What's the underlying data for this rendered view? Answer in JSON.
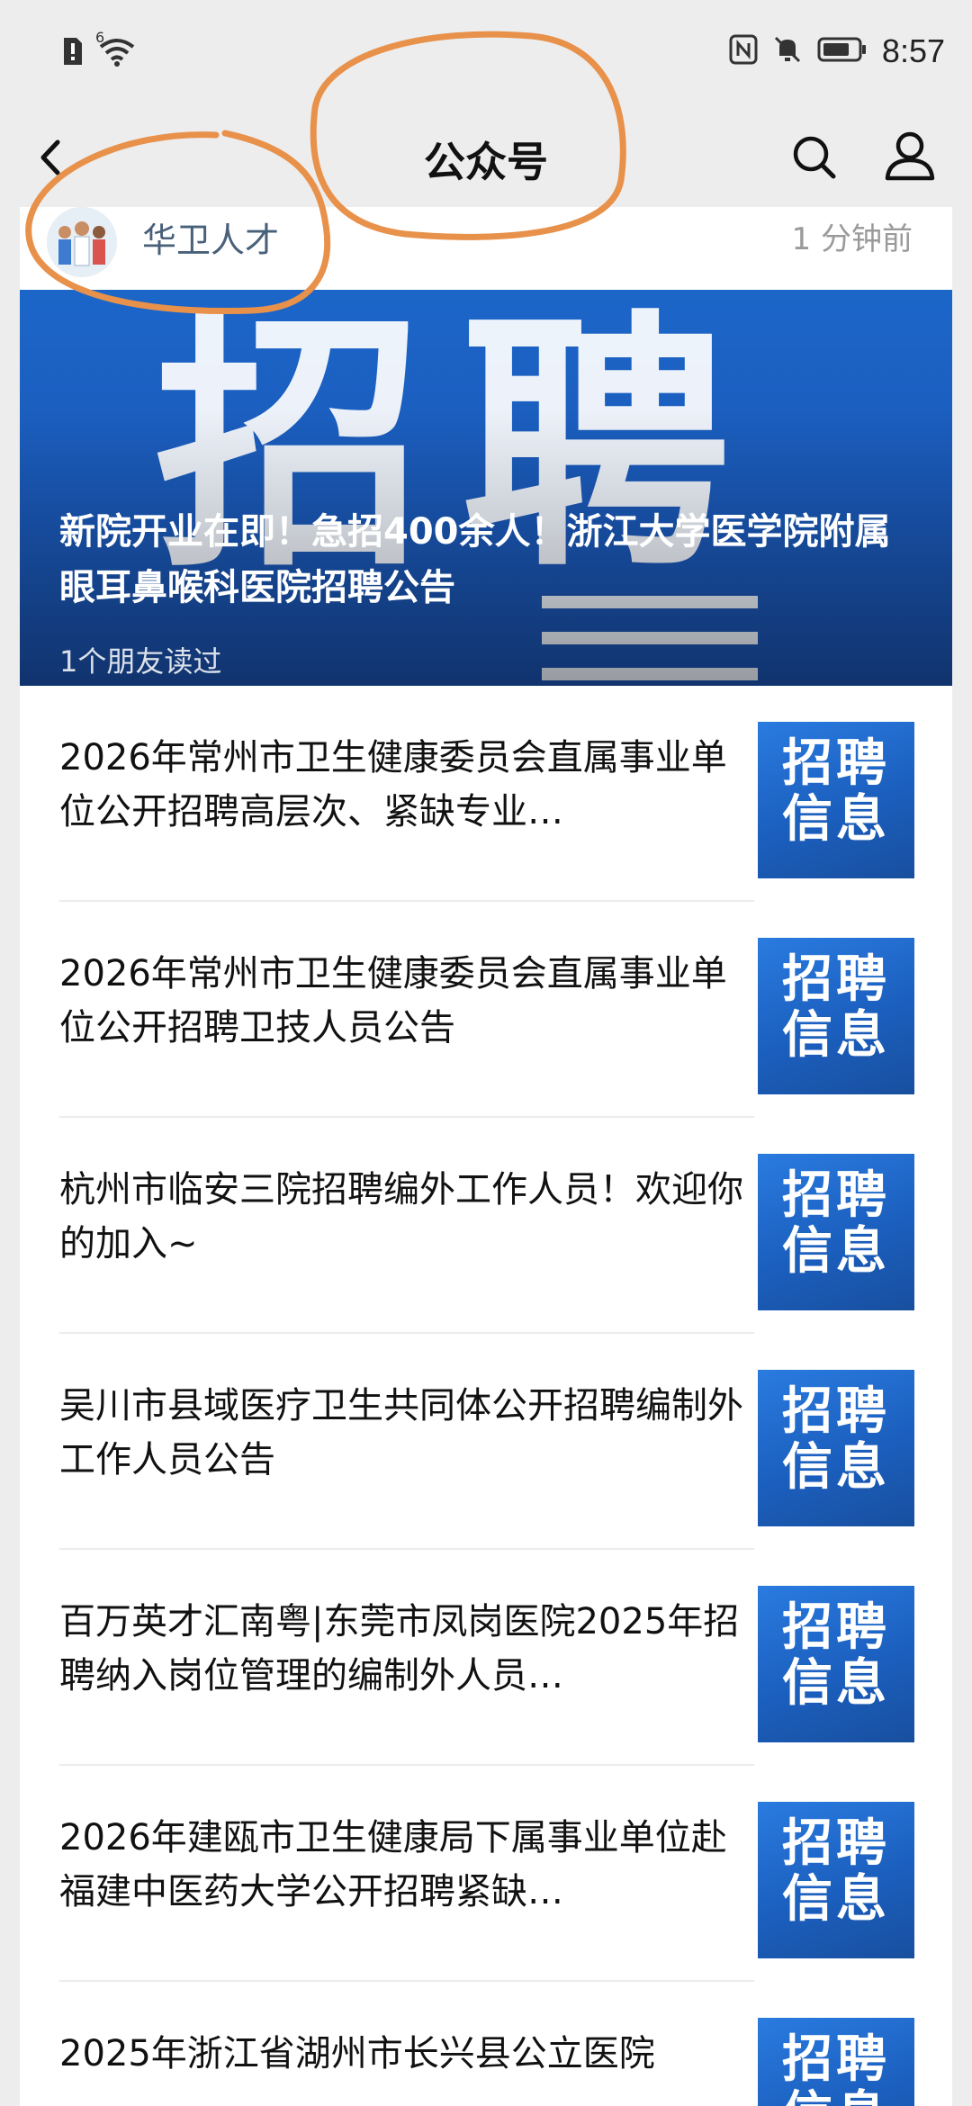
{
  "status_bar": {
    "time": "8:57",
    "network_badge": "6",
    "icons": [
      "sim-alert-icon",
      "wifi-icon",
      "nfc-icon",
      "mute-icon",
      "battery-icon"
    ]
  },
  "nav": {
    "title": "公众号",
    "icons": [
      "back-icon",
      "search-icon",
      "profile-icon"
    ]
  },
  "account": {
    "name": "华卫人才",
    "time": "1 分钟前"
  },
  "hero": {
    "banner_text": "招聘",
    "title": "新院开业在即！急招400余人！浙江大学医学院附属眼耳鼻喉科医院招聘公告",
    "meta": "1个朋友读过"
  },
  "articles": [
    {
      "title": "2026年常州市卫生健康委员会直属事业单位公开招聘高层次、紧缺专业…",
      "thumb_line1": "招聘",
      "thumb_line2": "信息"
    },
    {
      "title": "2026年常州市卫生健康委员会直属事业单位公开招聘卫技人员公告",
      "thumb_line1": "招聘",
      "thumb_line2": "信息"
    },
    {
      "title": "杭州市临安三院招聘编外工作人员！欢迎你的加入~",
      "thumb_line1": "招聘",
      "thumb_line2": "信息"
    },
    {
      "title": "吴川市县域医疗卫生共同体公开招聘编制外工作人员公告",
      "thumb_line1": "招聘",
      "thumb_line2": "信息"
    },
    {
      "title": "百万英才汇南粤|东莞市凤岗医院2025年招聘纳入岗位管理的编制外人员…",
      "thumb_line1": "招聘",
      "thumb_line2": "信息"
    },
    {
      "title": "2026年建瓯市卫生健康局下属事业单位赴福建中医药大学公开招聘紧缺…",
      "thumb_line1": "招聘",
      "thumb_line2": "信息"
    },
    {
      "title": "2025年浙江省湖州市长兴县公立医院",
      "thumb_line1": "招聘",
      "thumb_line2": "信息"
    }
  ],
  "colors": {
    "annotation": "#e8914a",
    "thumb_blue": "#1b5fbe",
    "account_name": "#48607a"
  }
}
